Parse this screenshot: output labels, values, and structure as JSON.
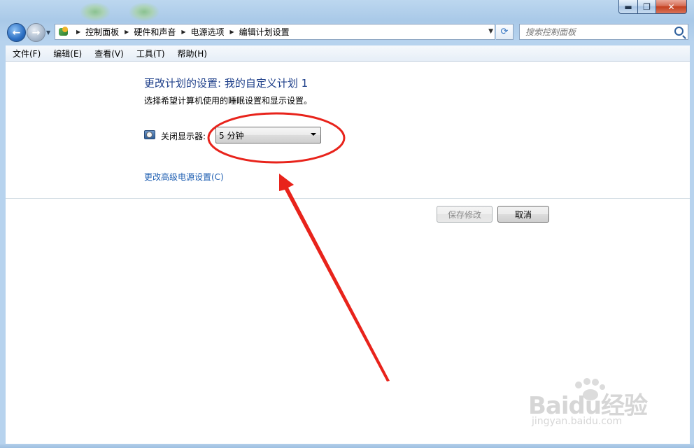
{
  "window": {
    "caption": {
      "minimize": "▬",
      "maximize": "❐",
      "close": "✕"
    }
  },
  "navigation": {
    "back": "←",
    "forward": "→",
    "breadcrumbs": [
      "控制面板",
      "硬件和声音",
      "电源选项",
      "编辑计划设置"
    ],
    "refresh": "⟳"
  },
  "search": {
    "placeholder": "搜索控制面板"
  },
  "menu": [
    "文件(F)",
    "编辑(E)",
    "查看(V)",
    "工具(T)",
    "帮助(H)"
  ],
  "main": {
    "heading": "更改计划的设置: 我的自定义计划 1",
    "subtitle": "选择希望计算机使用的睡眠设置和显示设置。",
    "display_off_label": "关闭显示器:",
    "display_off_value": "5 分钟",
    "advanced_link": "更改高级电源设置(C)",
    "save_button": "保存修改",
    "cancel_button": "取消"
  },
  "watermark": {
    "brand": "Baidu经验",
    "site": "jingyan.baidu.com"
  },
  "colors": {
    "heading": "#1e3f8a",
    "link": "#1f5fb2",
    "annotation": "#e8231b"
  },
  "icons": [
    "back-arrow-icon",
    "forward-arrow-icon",
    "control-panel-icon",
    "refresh-icon",
    "search-icon",
    "monitor-clock-icon",
    "dropdown-arrow-icon"
  ]
}
